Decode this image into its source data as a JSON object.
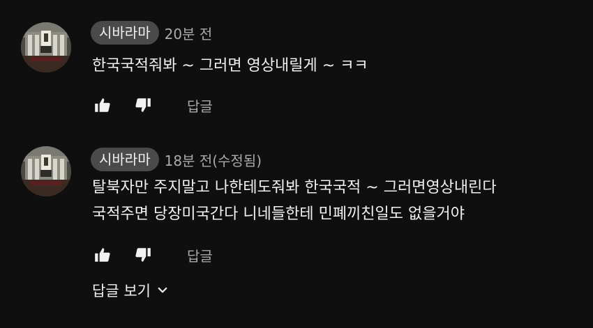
{
  "comments": [
    {
      "author": "시바라마",
      "time": "20분 전",
      "lines": [
        "한국국적줘봐 ~ 그러면 영상내릴게 ~ ㅋㅋ"
      ],
      "reply_label": "답글"
    },
    {
      "author": "시바라마",
      "time": "18분 전(수정됨)",
      "lines": [
        "탈북자만 주지말고 나한테도줘봐 한국국적 ~ 그러면영상내린다",
        "국적주면 당장미국간다 니네들한테 민폐끼친일도 없을거야"
      ],
      "reply_label": "답글",
      "view_replies_label": "답글 보기"
    }
  ],
  "icons": {
    "like": "thumb-up-icon",
    "dislike": "thumb-down-icon",
    "expand": "chevron-down-icon"
  },
  "colors": {
    "background": "#0f0f0f",
    "text": "#f1f1f1",
    "secondary_text": "#aaaaaa",
    "author_chip": "#4a4a4a"
  }
}
